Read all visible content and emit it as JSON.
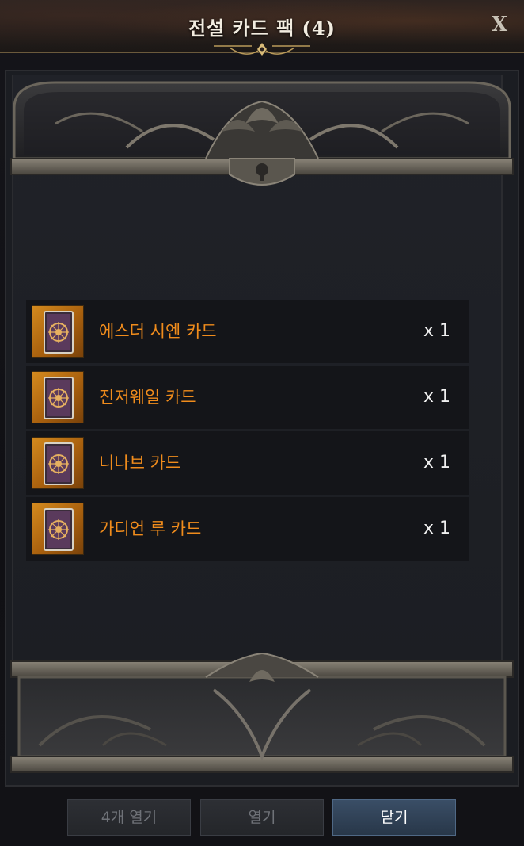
{
  "window": {
    "title": "전설 카드 팩 (4)",
    "close_label": "X"
  },
  "items": [
    {
      "name": "에스더 시엔 카드",
      "quantity": "x 1",
      "icon": "card-icon"
    },
    {
      "name": "진저웨일 카드",
      "quantity": "x 1",
      "icon": "card-icon"
    },
    {
      "name": "니나브 카드",
      "quantity": "x 1",
      "icon": "card-icon"
    },
    {
      "name": "가디언 루 카드",
      "quantity": "x 1",
      "icon": "card-icon"
    }
  ],
  "buttons": {
    "open_all": {
      "label": "4개 열기",
      "enabled": false
    },
    "open": {
      "label": "열기",
      "enabled": false
    },
    "close": {
      "label": "닫기",
      "enabled": true
    }
  },
  "colors": {
    "item_name": "#f08c1c",
    "primary_button": "#324559",
    "card_frame": "#d48a1e"
  }
}
